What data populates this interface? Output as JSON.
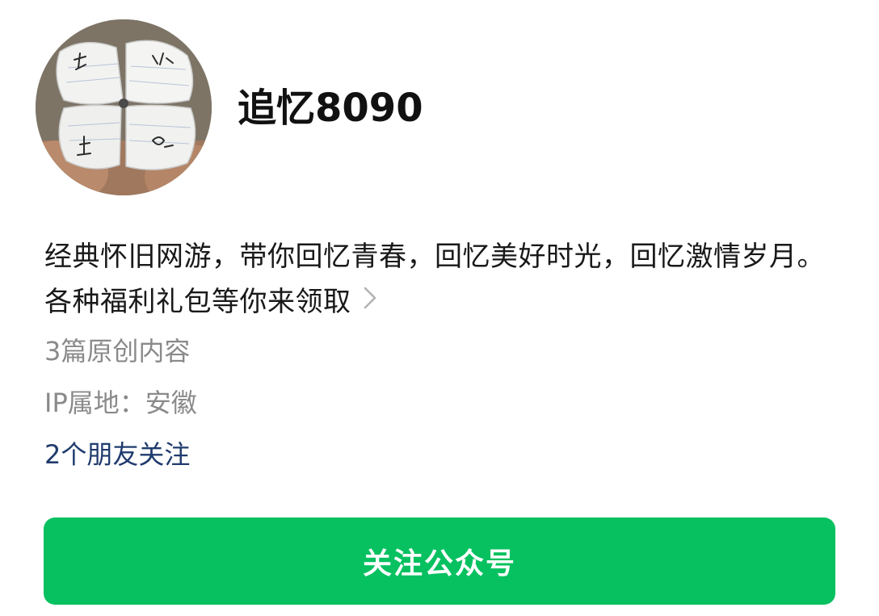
{
  "profile": {
    "name": "追忆8090",
    "description": "经典怀旧网游，带你回忆青春，回忆美好时光，回忆激情岁月。各种福利礼包等你来领取",
    "original_count": "3篇原创内容",
    "ip_location": "IP属地：安徽",
    "friends_following": "2个朋友关注"
  },
  "actions": {
    "follow_label": "关注公众号"
  },
  "colors": {
    "accent": "#07c160",
    "link": "#1f3b6d",
    "secondary_text": "#8a8a8a"
  }
}
